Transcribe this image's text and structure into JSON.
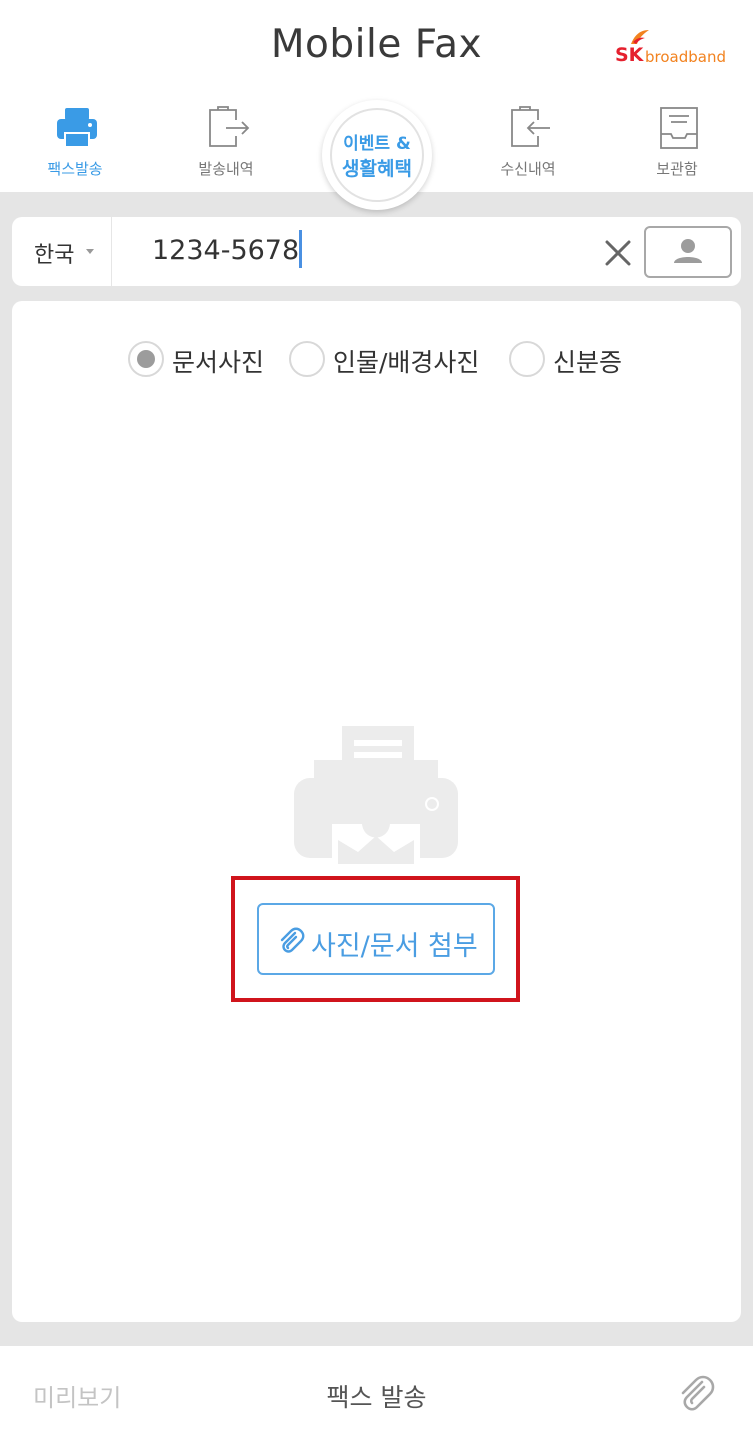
{
  "header": {
    "title": "Mobile Fax",
    "brand_sk": "SK",
    "brand_name": "broadband"
  },
  "tabs": [
    {
      "label": "팩스발송",
      "icon": "printer-icon",
      "active": true
    },
    {
      "label": "발송내역",
      "icon": "send-history-icon",
      "active": false
    },
    {
      "label": "수신내역",
      "icon": "receive-history-icon",
      "active": false
    },
    {
      "label": "보관함",
      "icon": "storage-box-icon",
      "active": false
    }
  ],
  "event": {
    "line1": "이벤트 &",
    "line2": "생활혜택"
  },
  "recipient": {
    "country": "한국",
    "phone": "1234-5678"
  },
  "photo_type": {
    "options": [
      "문서사진",
      "인물/배경사진",
      "신분증"
    ],
    "selected": "문서사진"
  },
  "attach_button": "사진/문서 첨부",
  "bottom": {
    "preview": "미리보기",
    "send": "팩스 발송"
  },
  "colors": {
    "accent": "#3a9be6",
    "highlight": "#d0141c",
    "background": "#e5e5e5"
  }
}
